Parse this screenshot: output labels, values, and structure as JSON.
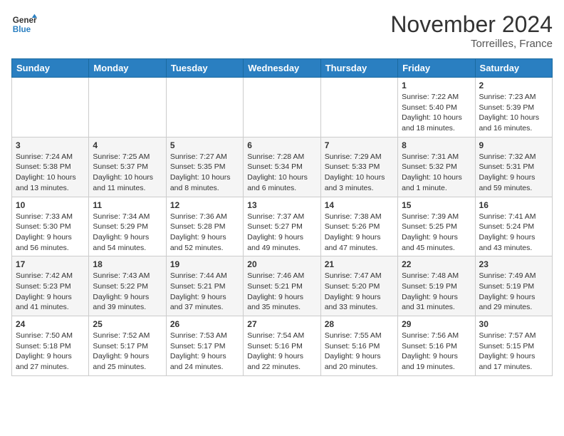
{
  "header": {
    "logo_line1": "General",
    "logo_line2": "Blue",
    "month": "November 2024",
    "location": "Torreilles, France"
  },
  "weekdays": [
    "Sunday",
    "Monday",
    "Tuesday",
    "Wednesday",
    "Thursday",
    "Friday",
    "Saturday"
  ],
  "weeks": [
    [
      {
        "day": "",
        "info": ""
      },
      {
        "day": "",
        "info": ""
      },
      {
        "day": "",
        "info": ""
      },
      {
        "day": "",
        "info": ""
      },
      {
        "day": "",
        "info": ""
      },
      {
        "day": "1",
        "info": "Sunrise: 7:22 AM\nSunset: 5:40 PM\nDaylight: 10 hours\nand 18 minutes."
      },
      {
        "day": "2",
        "info": "Sunrise: 7:23 AM\nSunset: 5:39 PM\nDaylight: 10 hours\nand 16 minutes."
      }
    ],
    [
      {
        "day": "3",
        "info": "Sunrise: 7:24 AM\nSunset: 5:38 PM\nDaylight: 10 hours\nand 13 minutes."
      },
      {
        "day": "4",
        "info": "Sunrise: 7:25 AM\nSunset: 5:37 PM\nDaylight: 10 hours\nand 11 minutes."
      },
      {
        "day": "5",
        "info": "Sunrise: 7:27 AM\nSunset: 5:35 PM\nDaylight: 10 hours\nand 8 minutes."
      },
      {
        "day": "6",
        "info": "Sunrise: 7:28 AM\nSunset: 5:34 PM\nDaylight: 10 hours\nand 6 minutes."
      },
      {
        "day": "7",
        "info": "Sunrise: 7:29 AM\nSunset: 5:33 PM\nDaylight: 10 hours\nand 3 minutes."
      },
      {
        "day": "8",
        "info": "Sunrise: 7:31 AM\nSunset: 5:32 PM\nDaylight: 10 hours\nand 1 minute."
      },
      {
        "day": "9",
        "info": "Sunrise: 7:32 AM\nSunset: 5:31 PM\nDaylight: 9 hours\nand 59 minutes."
      }
    ],
    [
      {
        "day": "10",
        "info": "Sunrise: 7:33 AM\nSunset: 5:30 PM\nDaylight: 9 hours\nand 56 minutes."
      },
      {
        "day": "11",
        "info": "Sunrise: 7:34 AM\nSunset: 5:29 PM\nDaylight: 9 hours\nand 54 minutes."
      },
      {
        "day": "12",
        "info": "Sunrise: 7:36 AM\nSunset: 5:28 PM\nDaylight: 9 hours\nand 52 minutes."
      },
      {
        "day": "13",
        "info": "Sunrise: 7:37 AM\nSunset: 5:27 PM\nDaylight: 9 hours\nand 49 minutes."
      },
      {
        "day": "14",
        "info": "Sunrise: 7:38 AM\nSunset: 5:26 PM\nDaylight: 9 hours\nand 47 minutes."
      },
      {
        "day": "15",
        "info": "Sunrise: 7:39 AM\nSunset: 5:25 PM\nDaylight: 9 hours\nand 45 minutes."
      },
      {
        "day": "16",
        "info": "Sunrise: 7:41 AM\nSunset: 5:24 PM\nDaylight: 9 hours\nand 43 minutes."
      }
    ],
    [
      {
        "day": "17",
        "info": "Sunrise: 7:42 AM\nSunset: 5:23 PM\nDaylight: 9 hours\nand 41 minutes."
      },
      {
        "day": "18",
        "info": "Sunrise: 7:43 AM\nSunset: 5:22 PM\nDaylight: 9 hours\nand 39 minutes."
      },
      {
        "day": "19",
        "info": "Sunrise: 7:44 AM\nSunset: 5:21 PM\nDaylight: 9 hours\nand 37 minutes."
      },
      {
        "day": "20",
        "info": "Sunrise: 7:46 AM\nSunset: 5:21 PM\nDaylight: 9 hours\nand 35 minutes."
      },
      {
        "day": "21",
        "info": "Sunrise: 7:47 AM\nSunset: 5:20 PM\nDaylight: 9 hours\nand 33 minutes."
      },
      {
        "day": "22",
        "info": "Sunrise: 7:48 AM\nSunset: 5:19 PM\nDaylight: 9 hours\nand 31 minutes."
      },
      {
        "day": "23",
        "info": "Sunrise: 7:49 AM\nSunset: 5:19 PM\nDaylight: 9 hours\nand 29 minutes."
      }
    ],
    [
      {
        "day": "24",
        "info": "Sunrise: 7:50 AM\nSunset: 5:18 PM\nDaylight: 9 hours\nand 27 minutes."
      },
      {
        "day": "25",
        "info": "Sunrise: 7:52 AM\nSunset: 5:17 PM\nDaylight: 9 hours\nand 25 minutes."
      },
      {
        "day": "26",
        "info": "Sunrise: 7:53 AM\nSunset: 5:17 PM\nDaylight: 9 hours\nand 24 minutes."
      },
      {
        "day": "27",
        "info": "Sunrise: 7:54 AM\nSunset: 5:16 PM\nDaylight: 9 hours\nand 22 minutes."
      },
      {
        "day": "28",
        "info": "Sunrise: 7:55 AM\nSunset: 5:16 PM\nDaylight: 9 hours\nand 20 minutes."
      },
      {
        "day": "29",
        "info": "Sunrise: 7:56 AM\nSunset: 5:16 PM\nDaylight: 9 hours\nand 19 minutes."
      },
      {
        "day": "30",
        "info": "Sunrise: 7:57 AM\nSunset: 5:15 PM\nDaylight: 9 hours\nand 17 minutes."
      }
    ]
  ]
}
